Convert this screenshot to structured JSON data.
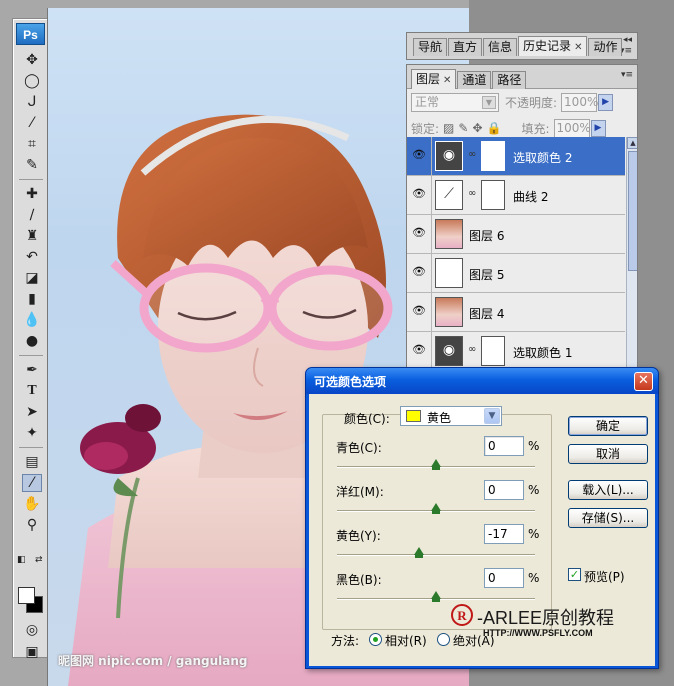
{
  "tools": {
    "logo": "Ps",
    "items": [
      "move",
      "marquee",
      "lasso",
      "quick-select",
      "crop",
      "slice",
      "healing",
      "brush",
      "stamp",
      "history-brush",
      "eraser",
      "gradient",
      "blur",
      "dodge",
      "pen",
      "type",
      "path-select",
      "shape",
      "notes",
      "eyedropper",
      "hand",
      "zoom"
    ],
    "active": "eyedropper",
    "foreground": "#ffffff",
    "background": "#000000"
  },
  "canvas": {
    "watermark": "昵图网 nipic.com / gangulang"
  },
  "history_panel": {
    "tabs": [
      "导航",
      "直方",
      "信息",
      "历史记录",
      "动作"
    ],
    "active_tab": "历史记录"
  },
  "layers_panel": {
    "tabs": [
      "图层",
      "通道",
      "路径"
    ],
    "active_tab": "图层",
    "blend_mode": "正常",
    "opacity_label": "不透明度:",
    "opacity_value": "100%",
    "lock_label": "锁定:",
    "fill_label": "填充:",
    "fill_value": "100%",
    "layers": [
      {
        "name": "选取颜色 2",
        "type": "adjustment",
        "selected": true
      },
      {
        "name": "曲线 2",
        "type": "curves",
        "selected": false
      },
      {
        "name": "图层 6",
        "type": "photo",
        "selected": false
      },
      {
        "name": "图层 5",
        "type": "transparent",
        "selected": false
      },
      {
        "name": "图层 4",
        "type": "photo",
        "selected": false
      },
      {
        "name": "选取颜色 1",
        "type": "adjustment",
        "selected": false
      }
    ]
  },
  "dialog": {
    "title": "可选颜色选项",
    "colors_label": "颜色(C):",
    "colors_value": "黄色",
    "swatch_color": "#ffff00",
    "sliders": [
      {
        "label": "青色(C):",
        "value": "0",
        "percent": 0
      },
      {
        "label": "洋红(M):",
        "value": "0",
        "percent": 0
      },
      {
        "label": "黄色(Y):",
        "value": "-17",
        "percent": -17
      },
      {
        "label": "黑色(B):",
        "value": "0",
        "percent": 0
      }
    ],
    "percent_sign": "%",
    "buttons": {
      "ok": "确定",
      "cancel": "取消",
      "load": "载入(L)...",
      "save": "存储(S)..."
    },
    "preview_label": "预览(P)",
    "preview_checked": true,
    "method_label": "方法:",
    "method_options": [
      "相对(R)",
      "绝对(A)"
    ],
    "method_selected": "相对(R)"
  },
  "branding": {
    "mark": "R",
    "text": "-ARLEE原创教程",
    "url": "HTTP://WWW.PSFLY.COM"
  }
}
